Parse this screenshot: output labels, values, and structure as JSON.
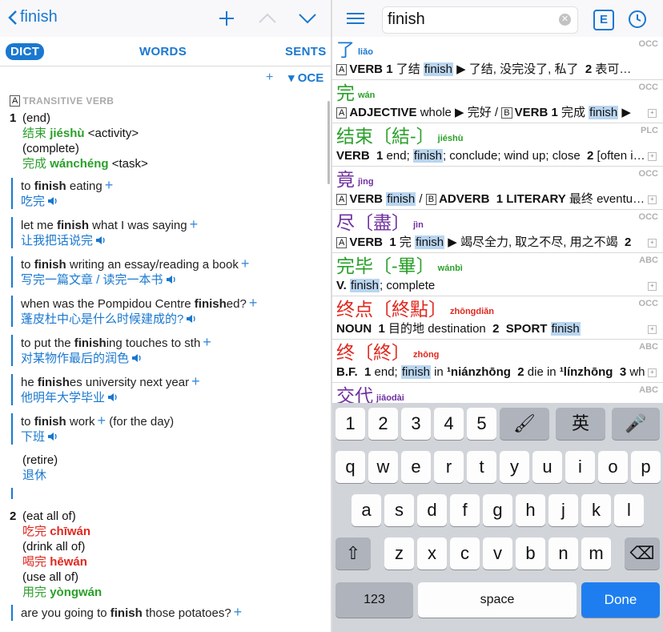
{
  "left": {
    "nav": {
      "back_label": "finish"
    },
    "segments": {
      "dict": "DICT",
      "words": "WORDS",
      "sents": "SENTS"
    },
    "tool": {
      "plus": "+",
      "oce": "▾ OCE"
    },
    "pos_box": "A",
    "pos_label": "TRANSITIVE VERB",
    "sense1": {
      "num": "1",
      "gloss1": "(end)",
      "zh1": "结束",
      "py1": "jiéshù",
      "note1": "<activity>",
      "gloss2": "(complete)",
      "zh2": "完成",
      "py2": "wánchéng",
      "note2": "<task>"
    },
    "examples": [
      {
        "pre": "to ",
        "bold": "finish",
        "post": " eating",
        "tr": "吃完"
      },
      {
        "pre": "let me ",
        "bold": "finish",
        "post": " what I was saying",
        "tr": "让我把话说完"
      },
      {
        "pre": "to ",
        "bold": "finish",
        "post": " writing an essay/reading a book",
        "tr": "写完一篇文章 / 读完一本书"
      },
      {
        "pre": "when was the Pompidou Centre ",
        "bold": "finish",
        "post": "ed?",
        "tr": "蓬皮杜中心是什么时候建成的?"
      },
      {
        "pre": "to put the ",
        "bold": "finish",
        "post": "ing touches to sth",
        "tr": "对某物作最后的润色"
      },
      {
        "pre": "he ",
        "bold": "finish",
        "post": "es university next year",
        "tr": "他明年大学毕业"
      },
      {
        "pre": "to ",
        "bold": "finish",
        "post": " work",
        "extra": "(for the day)",
        "tr": "下班"
      }
    ],
    "retire": {
      "gloss": "(retire)",
      "zh": "退休"
    },
    "sense2": {
      "num": "2",
      "g1": "(eat all of)",
      "z1": "吃完",
      "p1": "chīwán",
      "g2": "(drink all of)",
      "z2": "喝完",
      "p2": "hēwán",
      "g3": "(use all of)",
      "z3": "用完",
      "p3": "yòngwán"
    },
    "last_example": {
      "pre": "are you going to ",
      "bold": "finish",
      "post": " those potatoes?"
    }
  },
  "right": {
    "search": {
      "value": "finish"
    },
    "e_button": "E",
    "results": [
      {
        "hw": "了",
        "py": "liǎo",
        "src": "OCC",
        "color": "#1a78d0",
        "def_html": "<span class='boxA'>A</span><b>VERB</b> <b>1</b> 了结 <span class='hl'>finish</span> ▶ 了结, 没完没了, 私了 &nbsp;<b>2</b> 表可…"
      },
      {
        "hw": "完",
        "py": "wán",
        "src": "OCC",
        "color": "#2aa02a",
        "def_html": "<span class='boxA'>A</span><b>ADJECTIVE</b> whole ▶ 完好 / <span class='boxA'>B</span><b>VERB</b> <b>1</b> 完成 <span class='hl'>finish</span> ▶"
      },
      {
        "hw": "结束",
        "trad": "〔結-〕",
        "py": "jiéshù",
        "src": "PLC",
        "color": "#2aa02a",
        "def_html": "<b>VERB</b> &nbsp;<b>1</b> end; <span class='hl'>finish</span>; conclude; wind up; close &nbsp;<b>2</b> [often i…"
      },
      {
        "hw": "竟",
        "py": "jìng",
        "src": "OCC",
        "color": "#7030a0",
        "def_html": "<span class='boxA'>A</span><b>VERB</b> <span class='hl'>finish</span> / <span class='boxA'>B</span><b>ADVERB</b> &nbsp;<b>1</b> <b>LITERARY</b> 最终 eventu…"
      },
      {
        "hw": "尽",
        "trad": "〔盡〕",
        "py": "jìn",
        "src": "OCC",
        "color": "#7030a0",
        "def_html": "<span class='boxA'>A</span><b>VERB</b> &nbsp;<b>1</b> 完 <span class='hl'>finish</span> ▶ 竭尽全力, 取之不尽, 用之不竭 &nbsp;<b>2</b>"
      },
      {
        "hw": "完毕",
        "trad": "〔-畢〕",
        "py": "wánbì",
        "src": "ABC",
        "color": "#2aa02a",
        "def_html": "<b>V.</b> <span class='hl'>finish</span>; complete"
      },
      {
        "hw": "终点",
        "trad": "〔終點〕",
        "py": "zhōngdiǎn",
        "src": "OCC",
        "color": "#e0281e",
        "def_html": "<b>NOUN</b> &nbsp;<b>1</b> 目的地 destination &nbsp;<b>2</b> &nbsp;<b>SPORT</b> <span class='hl'>finish</span>"
      },
      {
        "hw": "终",
        "trad": "〔終〕",
        "py": "zhōng",
        "src": "ABC",
        "color": "#e0281e",
        "def_html": "<b>B.F.</b> &nbsp;<b>1</b> end; <span class='hl'>finish</span> in <b>¹niánzhōng</b> &nbsp;<b>2</b> die in <b>¹línzhōng</b> &nbsp;<b>3</b> wh"
      },
      {
        "hw": "交代",
        "py": "jiāodài",
        "src": "ABC",
        "color": "#7030a0",
        "def_html": ""
      }
    ],
    "keyboard": {
      "row1": [
        "1",
        "2",
        "3",
        "4",
        "5",
        "🖌",
        "英",
        "🎤"
      ],
      "row2": [
        "q",
        "w",
        "e",
        "r",
        "t",
        "y",
        "u",
        "i",
        "o",
        "p"
      ],
      "row3": [
        "a",
        "s",
        "d",
        "f",
        "g",
        "h",
        "j",
        "k",
        "l"
      ],
      "row4": [
        "z",
        "x",
        "c",
        "v",
        "b",
        "n",
        "m"
      ],
      "num_key": "123",
      "space": "space",
      "done": "Done"
    }
  }
}
